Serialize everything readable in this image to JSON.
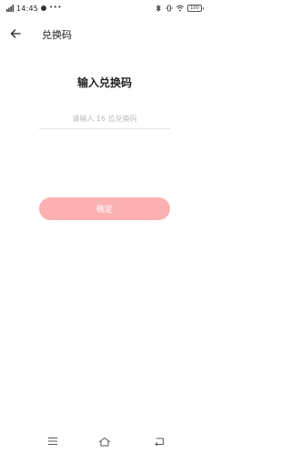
{
  "status_bar": {
    "signal_label": "4G",
    "time": "14:45",
    "more": "•••",
    "battery": "100"
  },
  "header": {
    "title": "兑换码"
  },
  "main": {
    "heading": "输入兑换码",
    "code_input": {
      "placeholder": "请输入 16 位兑换码",
      "value": ""
    },
    "confirm_label": "确定"
  },
  "colors": {
    "accent": "#fbb1b1",
    "divider": "#e3e3e3",
    "placeholder": "#b9b9b9"
  },
  "icons": {
    "back": "arrow-left-icon",
    "nav_menu": "menu-icon",
    "nav_home": "home-icon",
    "nav_back": "return-icon"
  }
}
